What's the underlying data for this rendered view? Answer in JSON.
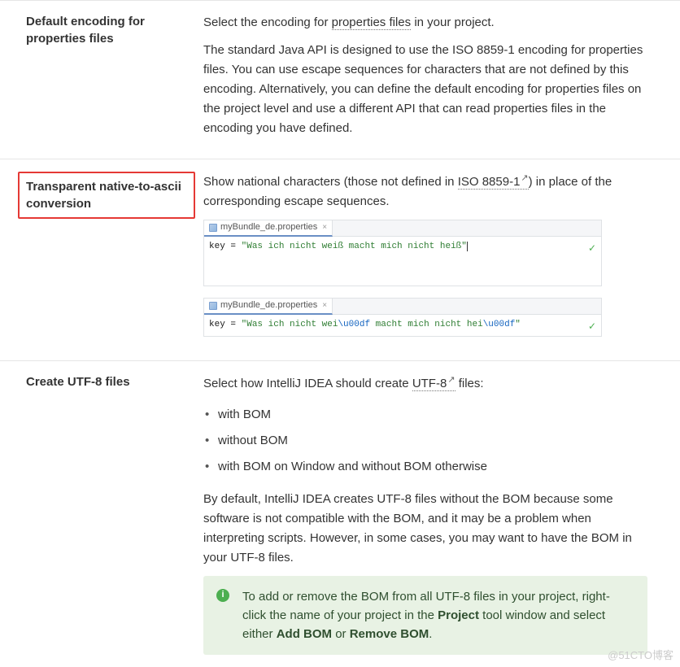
{
  "rows": {
    "defaultEncoding": {
      "title": "Default encoding for properties files",
      "p1_pre": "Select the encoding for ",
      "p1_link": "properties files",
      "p1_post": " in your project.",
      "p2": "The standard Java API is designed to use the ISO 8859-1 encoding for properties files. You can use escape sequences for characters that are not defined by this encoding. Alternatively, you can define the default encoding for properties files on the project level and use a different API that can read properties files in the encoding you have defined."
    },
    "transparent": {
      "title": "Transparent native-to-ascii conversion",
      "p1_pre": "Show national characters (those not defined in ",
      "p1_link": "ISO 8859-1",
      "p1_post": ") in place of the corresponding escape sequences.",
      "editor1": {
        "filename": "myBundle_de.properties",
        "code_key": "key",
        "code_eq": " = ",
        "code_str": "\"Was ich nicht weiß macht mich nicht heiß\""
      },
      "editor2": {
        "filename": "myBundle_de.properties",
        "code_key": "key",
        "code_eq": " = ",
        "code_str_a": "\"Was ich nicht wei",
        "code_esc1": "\\u00df",
        "code_str_b": " macht mich nicht hei",
        "code_esc2": "\\u00df",
        "code_str_c": "\""
      }
    },
    "createUtf8": {
      "title": "Create UTF-8 files",
      "p1_pre": "Select how IntelliJ IDEA should create ",
      "p1_link": "UTF-8",
      "p1_post": " files:",
      "bullets": [
        "with BOM",
        "without BOM",
        "with BOM on Window and without BOM otherwise"
      ],
      "p2": "By default, IntelliJ IDEA creates UTF-8 files without the BOM because some software is not compatible with the BOM, and it may be a problem when interpreting scripts. However, in some cases, you may want to have the BOM in your UTF-8 files.",
      "tip_pre": "To add or remove the BOM from all UTF-8 files in your project, right-click the name of your project in the ",
      "tip_b1": "Project",
      "tip_mid": " tool window and select either ",
      "tip_b2": "Add BOM",
      "tip_or": " or ",
      "tip_b3": "Remove BOM",
      "tip_end": "."
    }
  },
  "icons": {
    "ext": "↗",
    "check": "✓",
    "info": "i",
    "close": "×"
  },
  "watermark": "@51CTO博客"
}
